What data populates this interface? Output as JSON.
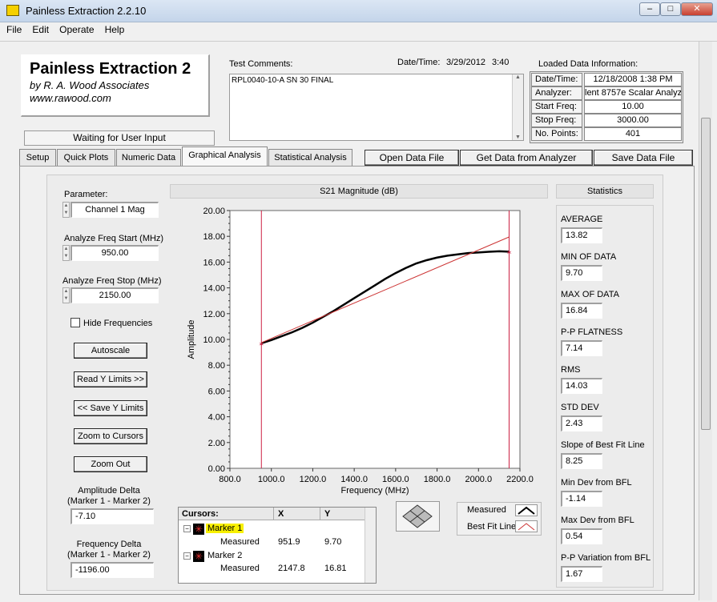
{
  "window": {
    "title": "Painless Extraction 2.2.10"
  },
  "menu": [
    "File",
    "Edit",
    "Operate",
    "Help"
  ],
  "app": {
    "name": "Painless Extraction 2",
    "author": "by R. A. Wood Associates",
    "url": "www.rawood.com",
    "status": "Waiting for User Input"
  },
  "comments": {
    "label": "Test Comments:",
    "text": "RPL0040-10-A SN 30 FINAL",
    "datetime_label": "Date/Time:",
    "date": "3/29/2012",
    "time": "3:40"
  },
  "loaded": {
    "label": "Loaded Data Information:",
    "rows": [
      {
        "k": "Date/Time:",
        "v": "12/18/2008 1:38 PM"
      },
      {
        "k": "Analyzer:",
        "v": "lent 8757e Scalar Analyz"
      },
      {
        "k": "Start Freq:",
        "v": "10.00"
      },
      {
        "k": "Stop Freq:",
        "v": "3000.00"
      },
      {
        "k": "No. Points:",
        "v": "401"
      }
    ]
  },
  "tabs": [
    "Setup",
    "Quick Plots",
    "Numeric Data",
    "Graphical Analysis",
    "Statistical Analysis"
  ],
  "actions": {
    "open": "Open Data File",
    "get": "Get Data from Analyzer",
    "save": "Save Data File"
  },
  "left": {
    "param_label": "Parameter:",
    "param_value": "Channel 1 Mag",
    "start_label": "Analyze Freq Start (MHz)",
    "start_value": "950.00",
    "stop_label": "Analyze Freq Stop (MHz)",
    "stop_value": "2150.00",
    "hide_label": "Hide Frequencies",
    "autoscale": "Autoscale",
    "read_y": "Read Y Limits >>",
    "save_y": "<< Save Y Limits",
    "zoom_cursors": "Zoom to Cursors",
    "zoom_out": "Zoom Out",
    "amp_delta_label1": "Amplitude Delta",
    "amp_delta_label2": "(Marker 1 - Marker 2)",
    "amp_delta": "-7.10",
    "freq_delta_label1": "Frequency Delta",
    "freq_delta_label2": "(Marker 1 - Marker 2)",
    "freq_delta": "-1196.00"
  },
  "chart_data": {
    "type": "line",
    "title": "S21 Magnitude (dB)",
    "xlabel": "Frequency (MHz)",
    "ylabel": "Amplitude",
    "xlim": [
      800,
      2200
    ],
    "ylim": [
      0,
      20
    ],
    "xticks": [
      "800.0",
      "1000.0",
      "1200.0",
      "1400.0",
      "1600.0",
      "1800.0",
      "2000.0",
      "2200.0"
    ],
    "yticks": [
      "0.00",
      "2.00",
      "4.00",
      "6.00",
      "8.00",
      "10.00",
      "12.00",
      "14.00",
      "16.00",
      "18.00",
      "20.00"
    ],
    "series": [
      {
        "name": "Measured",
        "color": "#000000",
        "x": [
          951.9,
          1000,
          1050,
          1100,
          1150,
          1200,
          1250,
          1300,
          1350,
          1400,
          1450,
          1500,
          1550,
          1600,
          1650,
          1700,
          1750,
          1800,
          1850,
          1900,
          1950,
          2000,
          2050,
          2100,
          2147.8
        ],
        "y": [
          9.7,
          9.95,
          10.25,
          10.55,
          10.9,
          11.3,
          11.75,
          12.2,
          12.7,
          13.2,
          13.7,
          14.2,
          14.7,
          15.15,
          15.55,
          15.9,
          16.15,
          16.35,
          16.5,
          16.6,
          16.7,
          16.75,
          16.8,
          16.84,
          16.81
        ]
      },
      {
        "name": "Best Fit Line",
        "color": "#cc3333",
        "x": [
          951.9,
          2147.8
        ],
        "y": [
          9.75,
          17.95
        ]
      }
    ],
    "cursors": [
      951.9,
      2147.8
    ]
  },
  "cursors": {
    "header": "Cursors:",
    "x_header": "X",
    "y_header": "Y",
    "items": [
      {
        "name": "Marker 1",
        "sub": "Measured",
        "x": "951.9",
        "y": "9.70"
      },
      {
        "name": "Marker 2",
        "sub": "Measured",
        "x": "2147.8",
        "y": "16.81"
      }
    ]
  },
  "legend": {
    "measured": "Measured",
    "bestfit": "Best Fit Line"
  },
  "stats": {
    "header": "Statistics",
    "items": [
      {
        "label": "AVERAGE",
        "value": "13.82"
      },
      {
        "label": "MIN OF DATA",
        "value": "9.70"
      },
      {
        "label": "MAX OF DATA",
        "value": "16.84"
      },
      {
        "label": "P-P FLATNESS",
        "value": "7.14"
      },
      {
        "label": "RMS",
        "value": "14.03"
      },
      {
        "label": "STD DEV",
        "value": "2.43"
      },
      {
        "label": "Slope of Best Fit Line",
        "value": "8.25"
      },
      {
        "label": "Min Dev from BFL",
        "value": "-1.14"
      },
      {
        "label": "Max Dev from BFL",
        "value": "0.54"
      },
      {
        "label": "P-P Variation from BFL",
        "value": "1.67"
      }
    ]
  }
}
